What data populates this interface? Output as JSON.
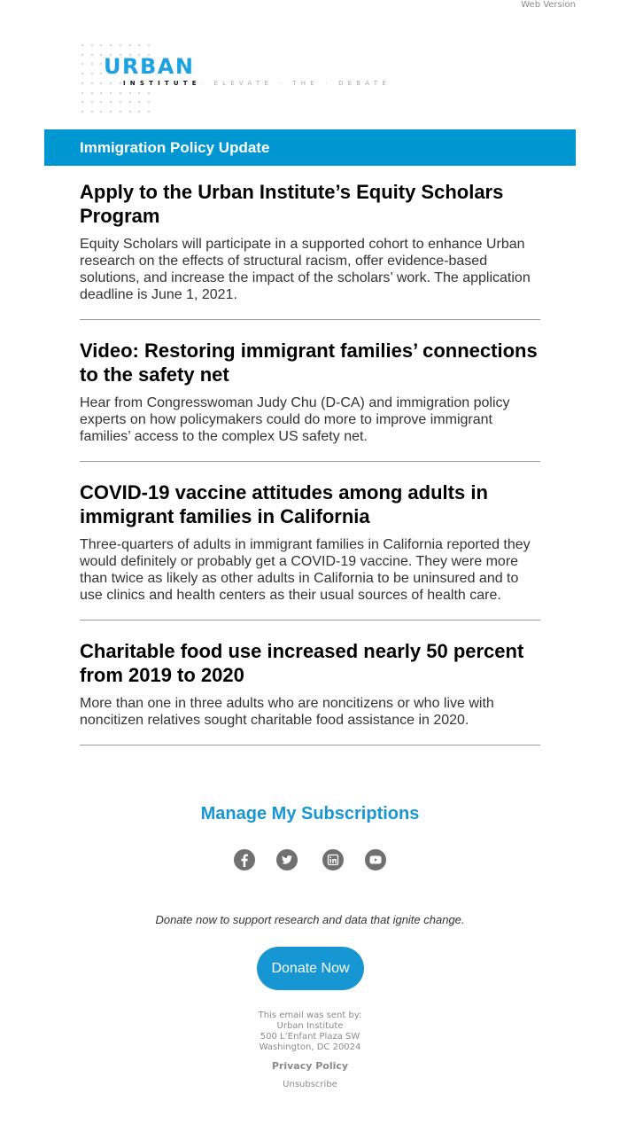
{
  "header": {
    "web_version_label": "Web Version"
  },
  "logo": {
    "wordmark": "URBAN",
    "institute": "INSTITUTE",
    "tagline": "· ELEVATE · THE · DEBATE",
    "wordmark_color": "#1ca2e0"
  },
  "banner": {
    "title": "Immigration Policy Update",
    "color": "#0096d2"
  },
  "articles": [
    {
      "title": "Apply to the Urban Institute’s Equity Scholars Program",
      "summary": "Equity Scholars will participate in a supported cohort to enhance Urban research on the effects of structural racism, offer evidence-based solutions, and increase the impact of the scholars’ work. The application deadline is June 1, 2021."
    },
    {
      "title": "Video: Restoring immigrant families’ connections to the safety net",
      "summary": "Hear from Congresswoman Judy Chu (D-CA) and immigration policy experts on how policymakers could do more to improve immigrant families’ access to the complex US safety net."
    },
    {
      "title": "COVID-19 vaccine attitudes among adults in immigrant families in California",
      "summary": "Three-quarters of adults in immigrant families in California reported they would definitely or probably get a COVID-19 vaccine. They were more than twice as likely as other adults in California to be uninsured and to use clinics and health centers as their usual sources of health care."
    },
    {
      "title": "Charitable food use increased nearly 50 percent from 2019 to 2020",
      "summary": "More than one in three adults who are noncitizens or who live with noncitizen relatives sought charitable food assistance in 2020."
    }
  ],
  "subscriptions": {
    "manage_label": "Manage My Subscriptions",
    "color": "#1696d2"
  },
  "social": [
    {
      "name": "facebook",
      "icon": "facebook-icon"
    },
    {
      "name": "twitter",
      "icon": "twitter-icon"
    },
    {
      "name": "linkedin",
      "icon": "linkedin-icon"
    },
    {
      "name": "youtube",
      "icon": "youtube-icon"
    }
  ],
  "donate": {
    "prompt": "Donate now to support research and data that ignite change.",
    "button_label": "Donate Now",
    "button_color": "#1696d2"
  },
  "footer": {
    "sent_by": "This email was sent by:",
    "org": "Urban Institute",
    "address_line1": "500 L’Enfant Plaza SW",
    "address_line2": "Washington, DC 20024",
    "privacy_label": "Privacy Policy",
    "unsubscribe_label": "Unsubscribe"
  }
}
